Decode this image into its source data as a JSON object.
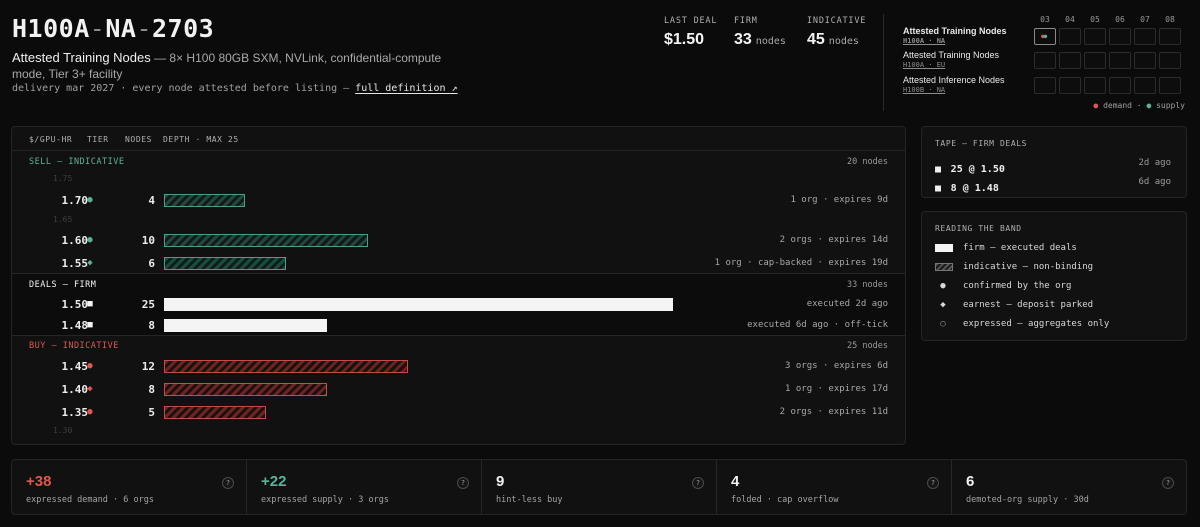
{
  "header": {
    "title_parts": [
      "H100A",
      "NA",
      "2703"
    ],
    "title_sep": "-",
    "subtitle_strong": "Attested Training Nodes",
    "subtitle_rest": " — 8× H100 80GB SXM, NVLink, confidential-compute mode, Tier 3+ facility",
    "delivery": "delivery mar 2027 · every node attested before listing — ",
    "definition_link": "full definition ↗"
  },
  "stats": {
    "last_deal": {
      "label": "LAST DEAL",
      "value": "$1.50"
    },
    "firm": {
      "label": "FIRM",
      "value": "33",
      "unit": "nodes"
    },
    "indicative": {
      "label": "INDICATIVE",
      "value": "45",
      "unit": "nodes"
    }
  },
  "months": [
    "03",
    "04",
    "05",
    "06",
    "07",
    "08"
  ],
  "products": [
    {
      "name": "Attested Training Nodes",
      "sub": "H100A · NA",
      "active": true
    },
    {
      "name": "Attested Training Nodes",
      "sub": "H100A · EU",
      "active": false
    },
    {
      "name": "Attested Inference Nodes",
      "sub": "H100B · NA",
      "active": false
    }
  ],
  "grid_legend": {
    "demand": "demand",
    "supply": "supply"
  },
  "book": {
    "columns": {
      "price": "$/GPU-HR",
      "tier": "TIER",
      "nodes": "NODES",
      "depth": "DEPTH · MAX 25"
    },
    "max_depth": 25,
    "sell": {
      "title": "SELL — INDICATIVE",
      "count": "20 nodes",
      "ghost_top": "1.75",
      "ghost_mid": "1.65",
      "rows": [
        {
          "price": "1.70",
          "tier": "confirmed",
          "mark": "●",
          "nodes": 4,
          "note": "1 org · expires 9d"
        },
        {
          "price": "1.60",
          "tier": "confirmed",
          "mark": "●",
          "nodes": 10,
          "note": "2 orgs · expires 14d"
        },
        {
          "price": "1.55",
          "tier": "earnest",
          "mark": "◆",
          "nodes": 6,
          "note": "1 org · cap-backed · expires 19d"
        }
      ]
    },
    "deals": {
      "title": "DEALS — FIRM",
      "count": "33 nodes",
      "rows": [
        {
          "price": "1.50",
          "mark": "■",
          "nodes": 25,
          "note": "executed 2d ago"
        },
        {
          "price": "1.48",
          "mark": "■",
          "nodes": 8,
          "note": "executed 6d ago · off-tick"
        }
      ]
    },
    "buy": {
      "title": "BUY — INDICATIVE",
      "count": "25 nodes",
      "ghost_bottom": "1.30",
      "rows": [
        {
          "price": "1.45",
          "tier": "confirmed",
          "mark": "●",
          "nodes": 12,
          "note": "3 orgs · expires 6d"
        },
        {
          "price": "1.40",
          "tier": "earnest",
          "mark": "◆",
          "nodes": 8,
          "note": "1 org · expires 17d"
        },
        {
          "price": "1.35",
          "tier": "confirmed",
          "mark": "●",
          "nodes": 5,
          "note": "2 orgs · expires 11d"
        }
      ]
    }
  },
  "tape": {
    "title": "TAPE — FIRM DEALS",
    "rows": [
      {
        "mark": "■",
        "deal": "25 @ 1.50",
        "when": "2d ago"
      },
      {
        "mark": "■",
        "deal": "8 @ 1.48",
        "when": "6d ago"
      }
    ]
  },
  "reading": {
    "title": "READING THE BAND",
    "items": [
      {
        "symbol": "firm-swatch",
        "text": "firm — executed deals"
      },
      {
        "symbol": "indicative-swatch",
        "text": "indicative — non-binding"
      },
      {
        "symbol": "●",
        "text": "confirmed by the org"
      },
      {
        "symbol": "◆",
        "text": "earnest — deposit parked"
      },
      {
        "symbol": "○",
        "text": "expressed — aggregates only"
      }
    ]
  },
  "metrics": [
    {
      "value": "+38",
      "label": "expressed demand · 6 orgs",
      "color": "#e0574f"
    },
    {
      "value": "+22",
      "label": "expressed supply · 3 orgs",
      "color": "#5bb39a"
    },
    {
      "value": "9",
      "label": "hint-less buy",
      "color": "#f0f0f0"
    },
    {
      "value": "4",
      "label": "folded · cap overflow",
      "color": "#f0f0f0"
    },
    {
      "value": "6",
      "label": "demoted-org supply · 30d",
      "color": "#f0f0f0"
    }
  ],
  "help_glyph": "?",
  "colors": {
    "sell": "#5bb39a",
    "buy": "#e0574f",
    "firm": "#f4f4f4",
    "bg": "#0b0b0b"
  }
}
